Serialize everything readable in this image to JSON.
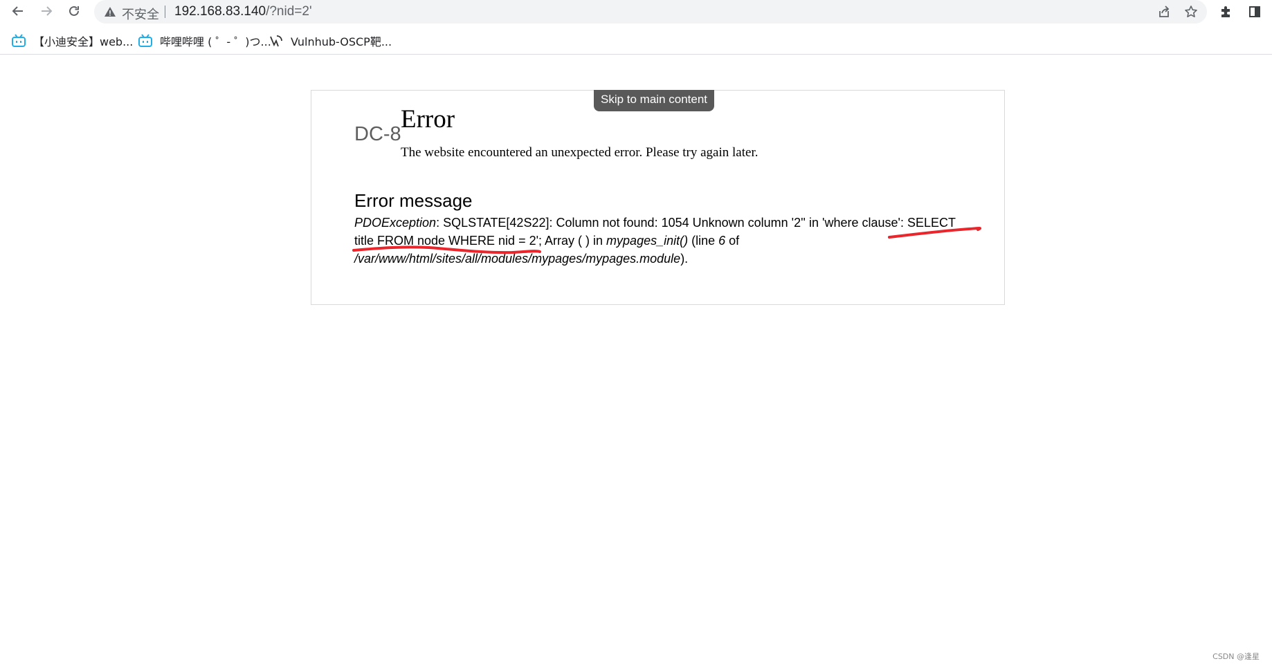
{
  "browser": {
    "security_label": "不安全",
    "url_host": "192.168.83.140",
    "url_path": "/?nid=2'",
    "bookmarks": [
      {
        "label": "【小迪安全】web..."
      },
      {
        "label": "哔哩哔哩 ( ゜- ゜)つ..."
      },
      {
        "label": "Vulnhub-OSCP靶..."
      }
    ]
  },
  "page": {
    "skip_link": "Skip to main content",
    "site_name": "DC-8",
    "title": "Error",
    "subtitle": "The website encountered an unexpected error. Please try again later.",
    "message_heading": "Error message",
    "exception_type": "PDOException",
    "line1_text": ": SQLSTATE[42S22]: Column not found: 1054 Unknown column '2'' in 'where clause': SELECT",
    "line2_text": "title FROM node WHERE nid = 2'; Array ( ) in ",
    "function_name": "mypages_init()",
    "line_word": " (line ",
    "line_number": "6",
    "of_word": " of",
    "file_path": "/var/www/html/sites/all/modules/mypages/mypages.module",
    "closing": ")."
  },
  "watermark": "CSDN @逢星",
  "colors": {
    "annotation": "#e8262c",
    "skip_bg": "#595959"
  }
}
